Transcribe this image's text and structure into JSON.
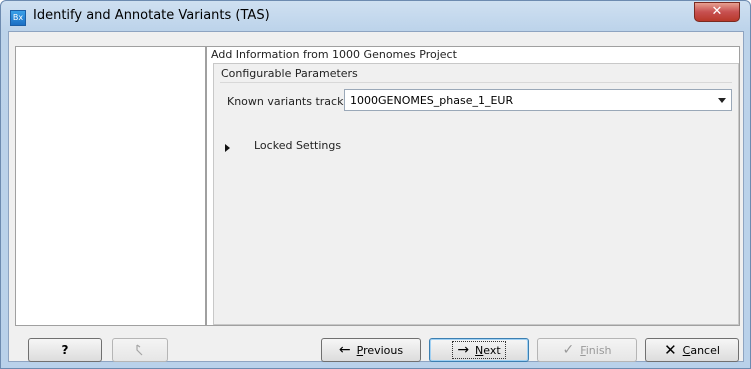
{
  "window": {
    "title": "Identify and Annotate Variants (TAS)",
    "app_icon_text": "Bx",
    "close_glyph": "✕"
  },
  "section": {
    "title": "Add Information from 1000 Genomes Project",
    "group_title": "Configurable Parameters",
    "known_variants_label": "Known variants track",
    "known_variants_value": "1000GENOMES_phase_1_EUR",
    "locked_settings_label": "Locked Settings"
  },
  "buttons": {
    "help": "?",
    "reset_icon": "reset-icon",
    "previous": {
      "icon": "←",
      "mnemonic": "P",
      "rest": "revious"
    },
    "next": {
      "icon": "→",
      "mnemonic": "N",
      "rest": "ext"
    },
    "finish": {
      "icon": "✓",
      "mnemonic": "F",
      "rest": "inish"
    },
    "cancel": {
      "icon": "✕",
      "mnemonic": "C",
      "rest": "ancel"
    }
  },
  "colors": {
    "cancel_icon": "#1a1a1a",
    "arrow_icon": "#1a1a1a",
    "close_button": "#c75050"
  }
}
